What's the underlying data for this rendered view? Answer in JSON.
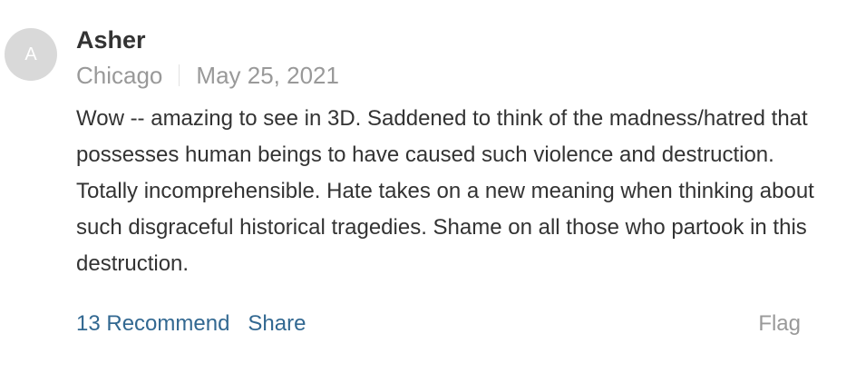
{
  "comment": {
    "avatar_initial": "A",
    "author": "Asher",
    "location": "Chicago",
    "date": "May 25, 2021",
    "body": "Wow -- amazing to see in 3D. Saddened to think of the madness/hatred that possesses human beings to have caused such violence and destruction. Totally incomprehensible. Hate takes on a new meaning when thinking about such disgraceful historical tragedies. Shame on all those who partook in this destruction.",
    "actions": {
      "recommend_label": "13 Recommend",
      "share_label": "Share",
      "flag_label": "Flag"
    }
  },
  "colors": {
    "link": "#326891",
    "muted": "#999999",
    "text": "#333333",
    "avatar_bg": "#d9d9d9"
  }
}
